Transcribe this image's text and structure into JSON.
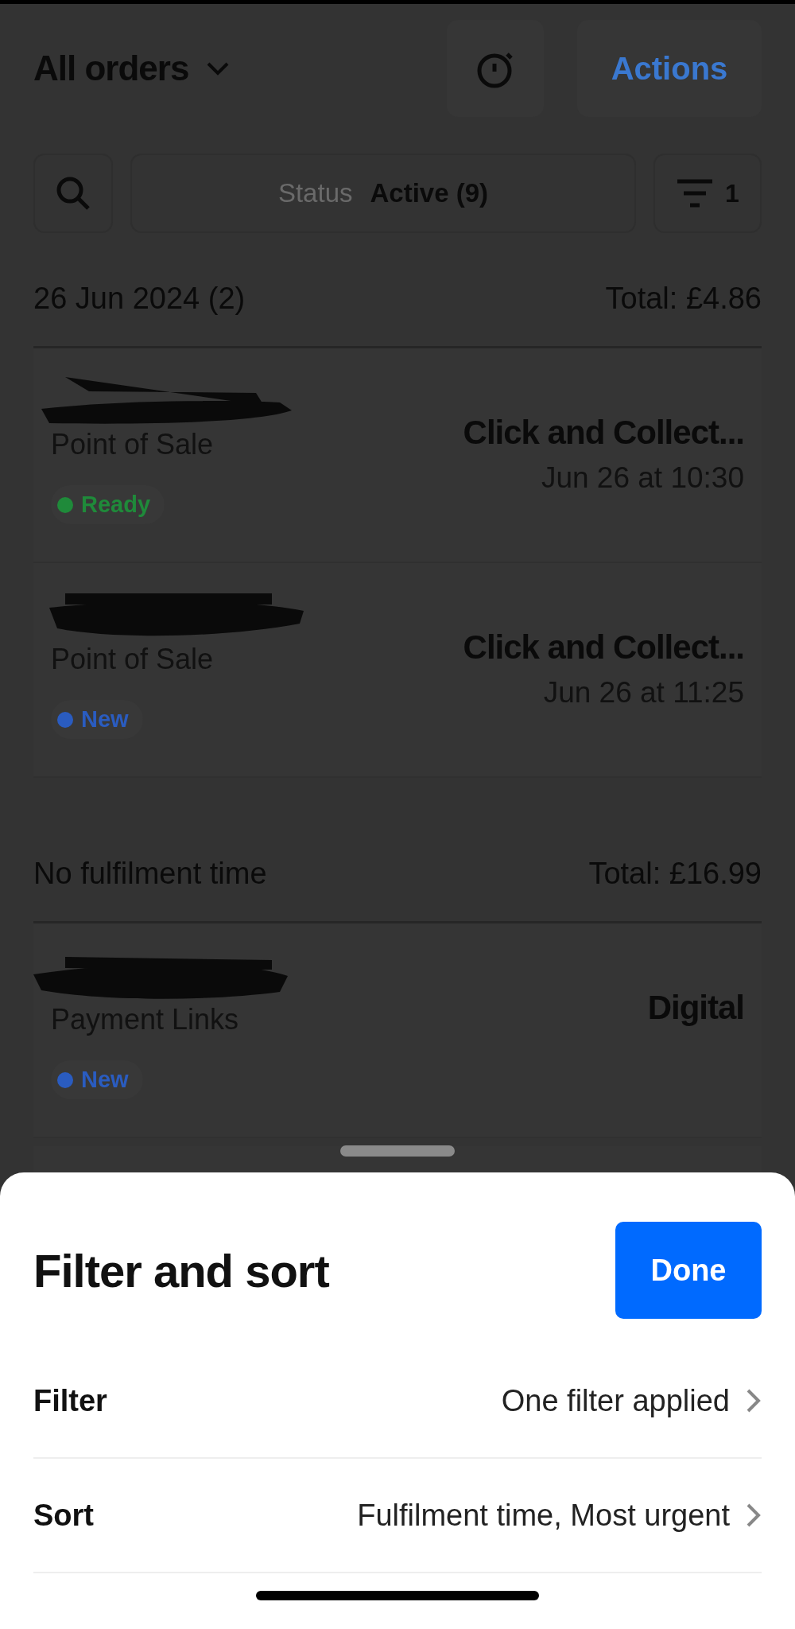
{
  "header": {
    "title": "All orders",
    "actions_button": "Actions"
  },
  "filter_bar": {
    "status_label": "Status",
    "status_value": "Active (9)",
    "filter_count": "1"
  },
  "groups": [
    {
      "title": "26 Jun 2024 (2)",
      "total": "Total: £4.86",
      "orders": [
        {
          "source": "Point of Sale",
          "status": "Ready",
          "color": "#1f8a3a",
          "type": "Click and Collect...",
          "time": "Jun 26 at 10:30"
        },
        {
          "source": "Point of Sale",
          "status": "New",
          "color": "#2a5cc0",
          "type": "Click and Collect...",
          "time": "Jun 26 at 11:25"
        }
      ]
    },
    {
      "title": "No fulfilment time",
      "total": "Total: £16.99",
      "orders": [
        {
          "source": "Payment Links",
          "status": "New",
          "color": "#2a5cc0",
          "type": "Digital"
        }
      ]
    }
  ],
  "sheet": {
    "title": "Filter and sort",
    "done_button": "Done",
    "rows": [
      {
        "label": "Filter",
        "value": "One filter applied"
      },
      {
        "label": "Sort",
        "value": "Fulfilment time, Most urgent"
      }
    ]
  }
}
